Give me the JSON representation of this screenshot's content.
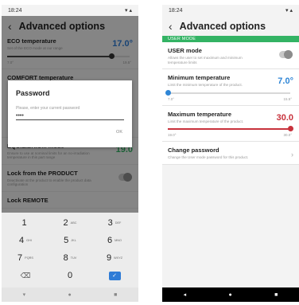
{
  "status": {
    "time": "18:24",
    "icons": "▾ ▴"
  },
  "header": {
    "back_icon": "‹",
    "title": "Advanced options"
  },
  "left": {
    "bg_rows": [
      {
        "title": "ECO temperature",
        "desc": "Set of the ECO mode at our range",
        "value": "17.0°",
        "value_color": "#2f7cd6",
        "min": "7.0°",
        "max": "19.5°",
        "fraction": 0.85
      },
      {
        "title": "COMFORT temperature"
      },
      {
        "title": "EQUILIBRIUM mode",
        "desc": "Ensure to use at nominal limits for an no-irradiation temperature in this part range",
        "value": "19.0"
      },
      {
        "title": "Lock from the PRODUCT",
        "desc": "Deactivate at the product to enable the product data configuration"
      },
      {
        "title": "Lock REMOTE"
      }
    ],
    "dialog": {
      "title": "Password",
      "label": "Please, enter your current password",
      "input_value": "••••",
      "ok_label": "OK"
    },
    "keypad": {
      "rows": [
        [
          {
            "n": "1",
            "s": ""
          },
          {
            "n": "2",
            "s": "ABC"
          },
          {
            "n": "3",
            "s": "DEF"
          }
        ],
        [
          {
            "n": "4",
            "s": "GHI"
          },
          {
            "n": "5",
            "s": "JKL"
          },
          {
            "n": "6",
            "s": "MNO"
          }
        ],
        [
          {
            "n": "7",
            "s": "PQRS"
          },
          {
            "n": "8",
            "s": "TUV"
          },
          {
            "n": "9",
            "s": "WXYZ"
          }
        ]
      ],
      "backspace": "⌫",
      "zero": "0",
      "done": "✓"
    },
    "navbar": {
      "back": "▾",
      "home": "●",
      "recent": "■"
    }
  },
  "right": {
    "section": "USER MODE",
    "user_mode": {
      "title": "USER mode",
      "desc": "Allows the user to set maximum and minimum temperature limits",
      "on": false
    },
    "min_temp": {
      "title": "Minimum temperature",
      "desc": "Limit the minimum temperature of the product.",
      "value": "7.0°",
      "min": "7.0°",
      "max": "15.5°",
      "fraction": 0.0,
      "color": "#2f86d6"
    },
    "max_temp": {
      "title": "Maximum temperature",
      "desc": "Limit the maximum temperature of the product.",
      "value": "30.0",
      "min": "19.0°",
      "max": "30.0°",
      "fraction": 1.0,
      "color": "#c8323c"
    },
    "change_password": {
      "title": "Change password",
      "desc": "Change the User mode password for this product."
    },
    "navbar": {
      "back": "◂",
      "home": "●",
      "recent": "■"
    }
  }
}
